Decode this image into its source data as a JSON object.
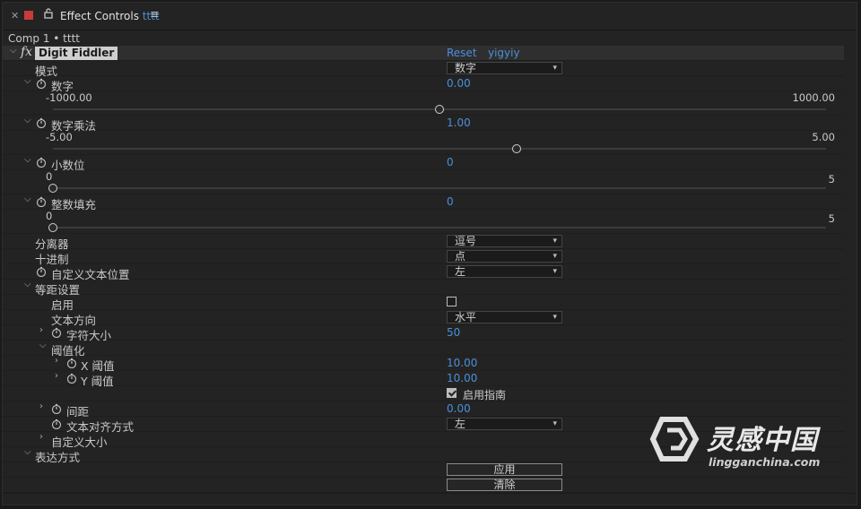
{
  "tab": {
    "title": "Effect Controls",
    "layer": "tttt"
  },
  "comp_label": "Comp 1 • tttt",
  "effect": {
    "name": "Digit Fiddler",
    "reset": "Reset",
    "about": "yigyiy"
  },
  "params": {
    "mode": {
      "label": "模式",
      "value": "数字"
    },
    "number": {
      "label": "数字",
      "value": "0.00",
      "min": "-1000.00",
      "max": "1000.00",
      "fraction": 0.5
    },
    "multiplier": {
      "label": "数字乘法",
      "value": "1.00",
      "min": "-5.00",
      "max": "5.00",
      "fraction": 0.6
    },
    "decimals": {
      "label": "小数位",
      "value": "0",
      "min": "0",
      "max": "5",
      "fraction": 0
    },
    "int_pad": {
      "label": "整数填充",
      "value": "0",
      "min": "0",
      "max": "5",
      "fraction": 0
    },
    "separator": {
      "label": "分离器",
      "value": "逗号"
    },
    "decimal_sep": {
      "label": "十进制",
      "value": "点"
    },
    "text_pos": {
      "label": "自定义文本位置",
      "value": "左"
    },
    "mono": {
      "label": "等距设置",
      "enable": {
        "label": "启用",
        "checked": false
      },
      "direction": {
        "label": "文本方向",
        "value": "水平"
      },
      "char_size": {
        "label": "字符大小",
        "value": "50"
      },
      "threshold": {
        "label": "阈值化",
        "x": {
          "label": "X 阈值",
          "value": "10.00"
        },
        "y": {
          "label": "Y 阈值",
          "value": "10.00"
        },
        "guide": {
          "label": "启用指南",
          "checked": true
        }
      },
      "spacing": {
        "label": "间距",
        "value": "0.00"
      },
      "align": {
        "label": "文本对齐方式",
        "value": "左"
      },
      "custom_size": {
        "label": "自定义大小"
      }
    },
    "expression": {
      "label": "表达方式",
      "apply": "应用",
      "clear": "清除"
    }
  },
  "watermark": {
    "cn": "灵感中国",
    "en": "lingganchina.com"
  },
  "colors": {
    "accent": "#4a90d9",
    "panel": "#232323",
    "close_square": "#c93b3b"
  }
}
